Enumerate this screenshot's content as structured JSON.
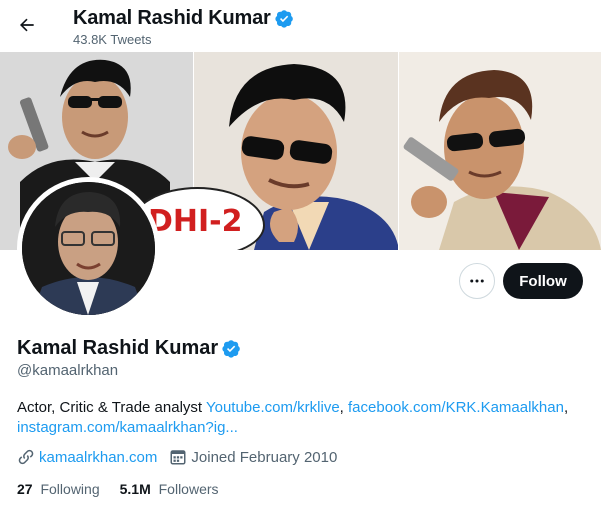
{
  "header": {
    "display_name": "Kamal Rashid Kumar",
    "tweet_count": "43.8K Tweets",
    "back_icon": "arrow-left-icon"
  },
  "banner": {
    "speech_bubble_text": "DHI-2"
  },
  "actions": {
    "more_icon": "more-dots-icon",
    "follow_label": "Follow"
  },
  "profile": {
    "display_name": "Kamal Rashid Kumar",
    "handle": "@kamaalrkhan",
    "verified_color": "#1d9bf0",
    "bio_text": "Actor, Critic & Trade analyst",
    "bio_links": [
      "Youtube.com/krklive",
      "facebook.com/KRK.Kamaalkhan",
      "instagram.com/kamaalrkhan?ig..."
    ],
    "website": "kamaalrkhan.com",
    "joined": "Joined February 2010",
    "following_count": "27",
    "following_label": "Following",
    "followers_count": "5.1M",
    "followers_label": "Followers"
  },
  "colors": {
    "accent": "#1d9bf0",
    "text_primary": "#0f1419",
    "text_secondary": "#536471",
    "follow_button_bg": "#0f1419"
  }
}
